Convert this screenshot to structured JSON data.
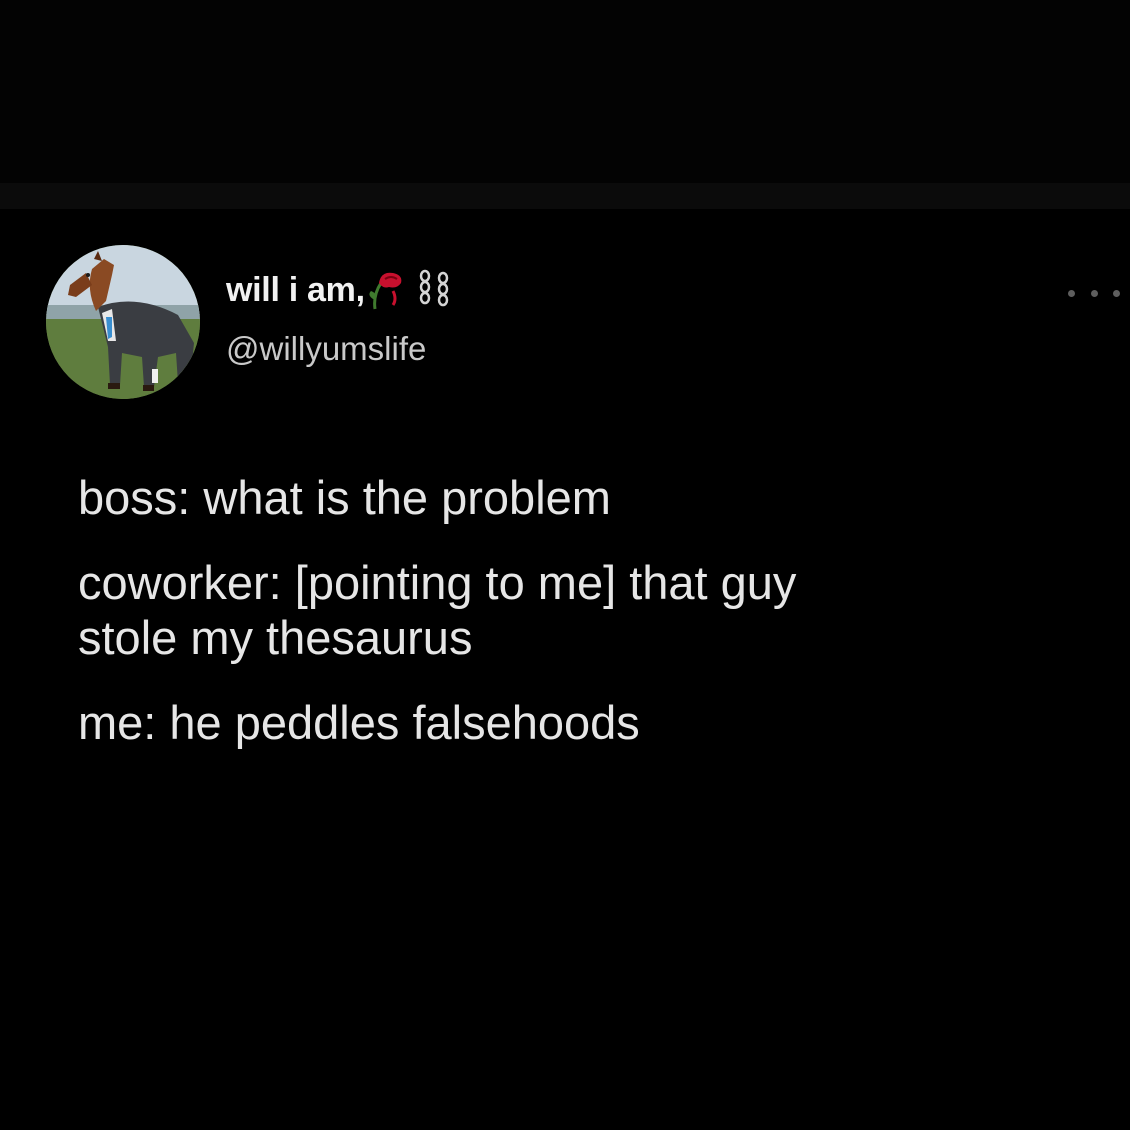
{
  "tweet": {
    "author": {
      "display_name": "will i am,",
      "handle": "@willyumslife",
      "avatar_icon": "horse-in-suit-avatar",
      "name_emojis": [
        "wilted-rose-icon",
        "chains-icon"
      ]
    },
    "more_icon": "ellipsis-icon",
    "lines": [
      "boss: what is the problem",
      "coworker: [pointing to me] that guy",
      "stole my thesaurus",
      "me: he peddles falsehoods"
    ]
  },
  "colors": {
    "background": "#000000",
    "text_primary": "#e6e6e6",
    "text_secondary": "#c9c9c9",
    "rose_red": "#c8102e"
  }
}
